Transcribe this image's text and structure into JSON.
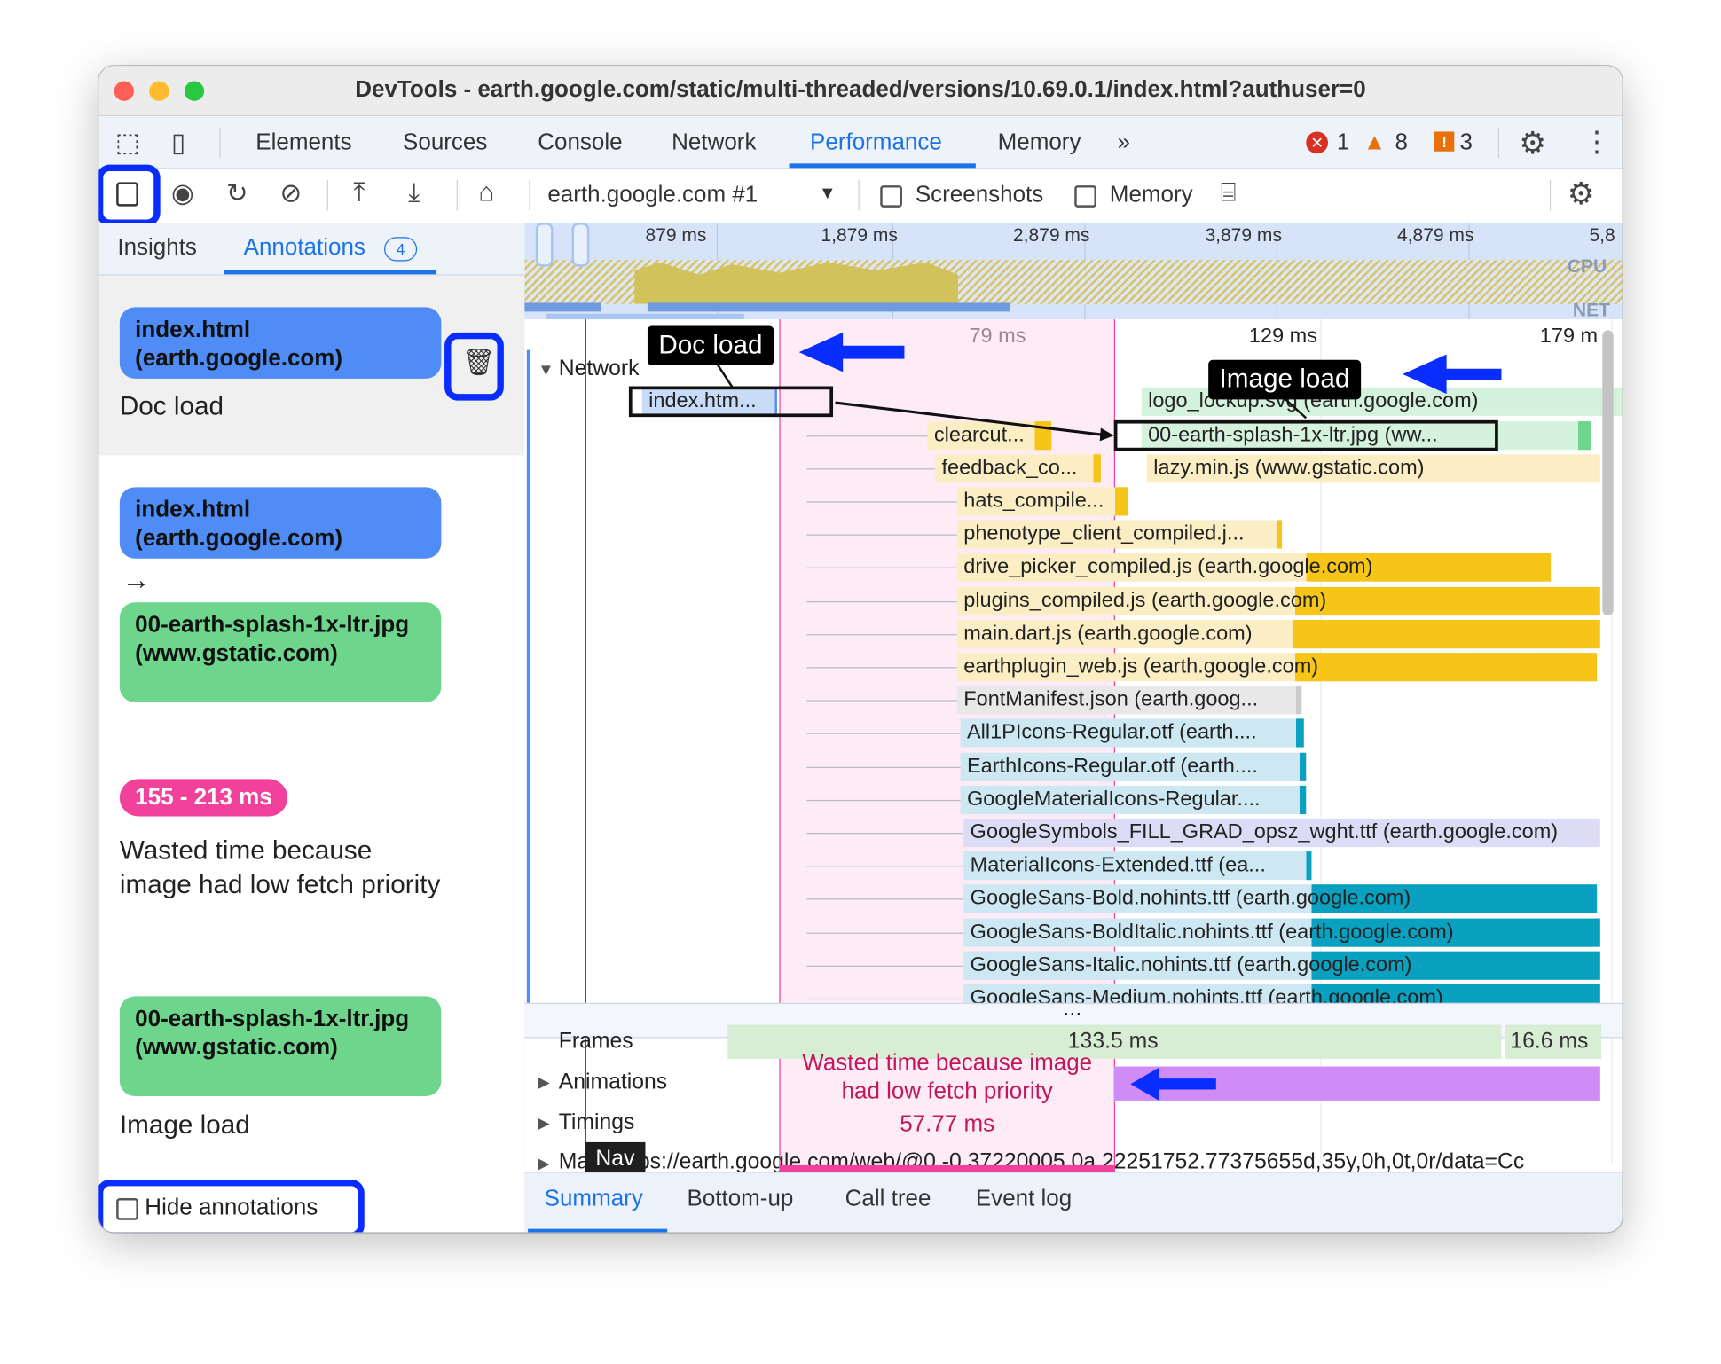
{
  "window": {
    "title": "DevTools - earth.google.com/static/multi-threaded/versions/10.69.0.1/index.html?authuser=0"
  },
  "tabs": [
    "Elements",
    "Sources",
    "Console",
    "Network",
    "Performance",
    "Memory"
  ],
  "active_tab": "Performance",
  "badges": {
    "errors": "1",
    "warnings": "8",
    "issues": "3"
  },
  "toolbar": {
    "target": "earth.google.com #1",
    "screenshots_label": "Screenshots",
    "memory_label": "Memory",
    "screenshots_checked": false,
    "memory_checked": false
  },
  "sidebar": {
    "tabs": [
      {
        "label": "Insights"
      },
      {
        "label": "Annotations",
        "count": "4"
      }
    ],
    "annotations": [
      {
        "chip": "index.html (earth.google.com)",
        "label": "Doc load"
      },
      {
        "from": "index.html (earth.google.com)",
        "arrow": "→",
        "to": "00-earth-splash-1x-ltr.jpg (www.gstatic.com)"
      },
      {
        "range": "155 - 213 ms",
        "label": "Wasted time because image had low fetch priority"
      },
      {
        "chip": "00-earth-splash-1x-ltr.jpg (www.gstatic.com)",
        "label": "Image load"
      }
    ],
    "hide_annotations": "Hide annotations"
  },
  "overview": {
    "ticks": [
      "879 ms",
      "1,879 ms",
      "2,879 ms",
      "3,879 ms",
      "4,879 ms",
      "5,8"
    ],
    "cpu_label": "CPU",
    "net_label": "NET"
  },
  "timeline": {
    "ticks": [
      "79 ms",
      "129 ms",
      "179 m"
    ],
    "network_label": "Network",
    "callouts": {
      "doc": "Doc load",
      "image": "Image load"
    },
    "requests": [
      {
        "label": "index.htm...",
        "color": "#c9dcf7"
      },
      {
        "label": "logo_lockup.svg (earth.google.com)",
        "color": "#d5f3dc"
      },
      {
        "label": "00-earth-splash-1x-ltr.jpg (ww...",
        "color": "#d5f3dc"
      },
      {
        "label": "clearcut...",
        "color": "#fbeec4"
      },
      {
        "label": "lazy.min.js (www.gstatic.com)",
        "color": "#fbeec4"
      },
      {
        "label": "feedback_co...",
        "color": "#fbeec4"
      },
      {
        "label": "hats_compile...",
        "color": "#fbeec4"
      },
      {
        "label": "phenotype_client_compiled.j...",
        "color": "#fbeec4"
      },
      {
        "label": "drive_picker_compiled.js (earth.google.com)",
        "color": "#fbeec4"
      },
      {
        "label": "plugins_compiled.js (earth.google.com)",
        "color": "#fbeec4"
      },
      {
        "label": "main.dart.js (earth.google.com)",
        "color": "#fbeec4"
      },
      {
        "label": "earthplugin_web.js (earth.google.com)",
        "color": "#fbeec4"
      },
      {
        "label": "FontManifest.json (earth.goog...",
        "color": "#e8e8e8"
      },
      {
        "label": "All1PIcons-Regular.otf (earth....",
        "color": "#cde8f2"
      },
      {
        "label": "EarthIcons-Regular.otf (earth....",
        "color": "#cde8f2"
      },
      {
        "label": "GoogleMaterialIcons-Regular....",
        "color": "#cde8f2"
      },
      {
        "label": "GoogleSymbols_FILL_GRAD_opsz_wght.ttf (earth.google.com)",
        "color": "#dcdcf6"
      },
      {
        "label": "MaterialIcons-Extended.ttf (ea...",
        "color": "#cde8f2"
      },
      {
        "label": "GoogleSans-Bold.nohints.ttf (earth.google.com)",
        "color": "#cde8f2"
      },
      {
        "label": "GoogleSans-BoldItalic.nohints.ttf (earth.google.com)",
        "color": "#cde8f2"
      },
      {
        "label": "GoogleSans-Italic.nohints.ttf (earth.google.com)",
        "color": "#cde8f2"
      },
      {
        "label": "GoogleSans-Medium.nohints.ttf (earth.google.com)",
        "color": "#cde8f2"
      }
    ],
    "tracks": {
      "frames": "Frames",
      "frame1": "133.5 ms",
      "frame2": "16.6 ms",
      "animations": "Animations",
      "timings": "Timings",
      "main": "Ma",
      "nav": "Nav",
      "main_url": "https://earth.google.com/web/@0,-0.37220005,0a,22251752.77375655d,35y,0h,0t,0r/data=Cc"
    },
    "wasted": {
      "line1": "Wasted time because image",
      "line2": "had low fetch priority",
      "duration": "57.77 ms"
    }
  },
  "bottom_tabs": [
    "Summary",
    "Bottom-up",
    "Call tree",
    "Event log"
  ],
  "colors": {
    "accent": "#1a73e8",
    "highlight": "#0a2dff",
    "annotation_pink": "#f2419b"
  }
}
